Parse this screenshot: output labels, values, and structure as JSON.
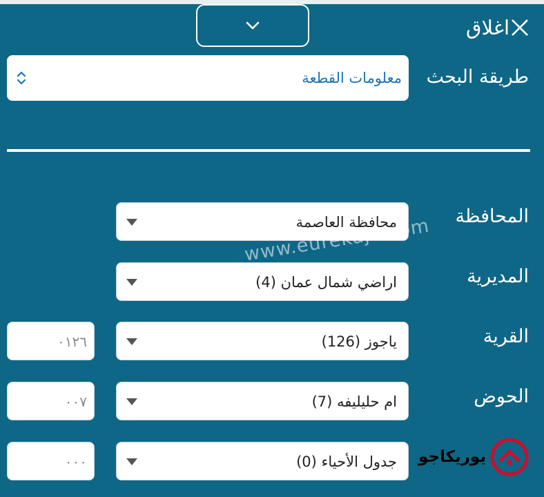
{
  "header": {
    "close_label": "اغلاق",
    "collapse_icon": "chevron-down-icon",
    "close_icon": "close-icon"
  },
  "search_method": {
    "label": "طريقة البحث",
    "value": "معلومات القطعة",
    "icon": "updown-chevron-icon"
  },
  "fields": [
    {
      "label": "المحافظة",
      "value": "محافظة العاصمة"
    },
    {
      "label": "المديرية",
      "value": "اراضي شمال عمان (4)"
    },
    {
      "label": "القرية",
      "value": "ياجوز (126)",
      "code": "٠١٢٦"
    },
    {
      "label": "الحوض",
      "value": "ام حليليفه (7)",
      "code": "٠٠٧"
    },
    {
      "label": "",
      "value": "جدول الأحياء (0)",
      "code": "٠٠٠"
    }
  ],
  "watermark": "www.eurekajo.com",
  "logo": {
    "text": "يوريكاجو"
  },
  "colors": {
    "background": "#0e6787",
    "link_value": "#1a73b8",
    "logo_red": "#c8102e"
  }
}
